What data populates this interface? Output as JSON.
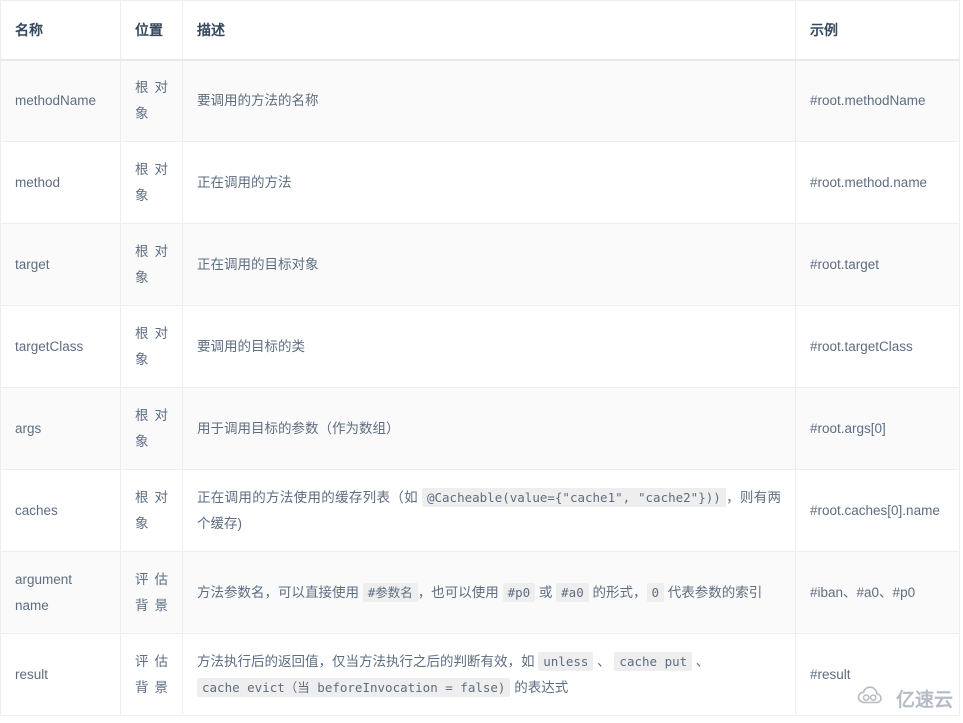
{
  "table": {
    "headers": [
      {
        "label": "名称",
        "key": "name"
      },
      {
        "label": "位置",
        "key": "position"
      },
      {
        "label": "描述",
        "key": "description"
      },
      {
        "label": "示例",
        "key": "example"
      }
    ],
    "rows": [
      {
        "name": "methodName",
        "position": "根 对 象",
        "position_lines": [
          "根 对",
          "象"
        ],
        "description": "要调用的方法的名称",
        "example": "#root.methodName"
      },
      {
        "name": "method",
        "position": "根 对 象",
        "position_lines": [
          "根 对",
          "象"
        ],
        "description": "正在调用的方法",
        "example": "#root.method.name"
      },
      {
        "name": "target",
        "position": "根 对 象",
        "position_lines": [
          "根 对",
          "象"
        ],
        "description": "正在调用的目标对象",
        "example": "#root.target"
      },
      {
        "name": "targetClass",
        "position": "根 对 象",
        "position_lines": [
          "根 对",
          "象"
        ],
        "description": "要调用的目标的类",
        "example": "#root.targetClass"
      },
      {
        "name": "args",
        "position": "根 对 象",
        "position_lines": [
          "根 对",
          "象"
        ],
        "description": "用于调用目标的参数（作为数组）",
        "example": "#root.args[0]"
      },
      {
        "name": "caches",
        "position": "根 对 象",
        "position_lines": [
          "根 对",
          "象"
        ],
        "description_parts": [
          {
            "type": "text",
            "value": "正在调用的方法使用的缓存列表（如 "
          },
          {
            "type": "code",
            "value": "@Cacheable(value={\"cache1\", \"cache2\"}))"
          },
          {
            "type": "text",
            "value": "，则有两个缓存)"
          }
        ],
        "example": "#root.caches[0].name"
      },
      {
        "name": "argument name",
        "position": "评 估 背 景",
        "position_lines": [
          "评 估",
          "背景"
        ],
        "description_parts": [
          {
            "type": "text",
            "value": "方法参数名，可以直接使用 "
          },
          {
            "type": "code",
            "value": "#参数名"
          },
          {
            "type": "text",
            "value": "，也可以使用 "
          },
          {
            "type": "code",
            "value": "#p0"
          },
          {
            "type": "text",
            "value": " 或 "
          },
          {
            "type": "code",
            "value": "#a0"
          },
          {
            "type": "text",
            "value": " 的形式，"
          },
          {
            "type": "code",
            "value": "0"
          },
          {
            "type": "text",
            "value": " 代表参数的索引"
          }
        ],
        "example": "#iban、#a0、#p0"
      },
      {
        "name": "result",
        "position": "评 估 背 景",
        "position_lines": [
          "评 估",
          "背景"
        ],
        "description_parts": [
          {
            "type": "text",
            "value": "方法执行后的返回值，仅当方法执行之后的判断有效，如 "
          },
          {
            "type": "code",
            "value": "unless"
          },
          {
            "type": "text",
            "value": " 、 "
          },
          {
            "type": "code",
            "value": "cache put"
          },
          {
            "type": "text",
            "value": " 、 "
          },
          {
            "type": "code",
            "value": "cache evict（当 beforeInvocation = false)"
          },
          {
            "type": "text",
            "value": " 的表达式"
          }
        ],
        "example": "#result"
      }
    ]
  },
  "watermark": {
    "text": "亿速云",
    "icon": "cloud-logo-icon"
  },
  "colors": {
    "header_text": "#34495e",
    "body_text": "#5e6d82",
    "border": "#eceef0",
    "row_odd_bg": "#fafafa",
    "row_even_bg": "#ffffff",
    "code_bg": "#eeeeee"
  }
}
